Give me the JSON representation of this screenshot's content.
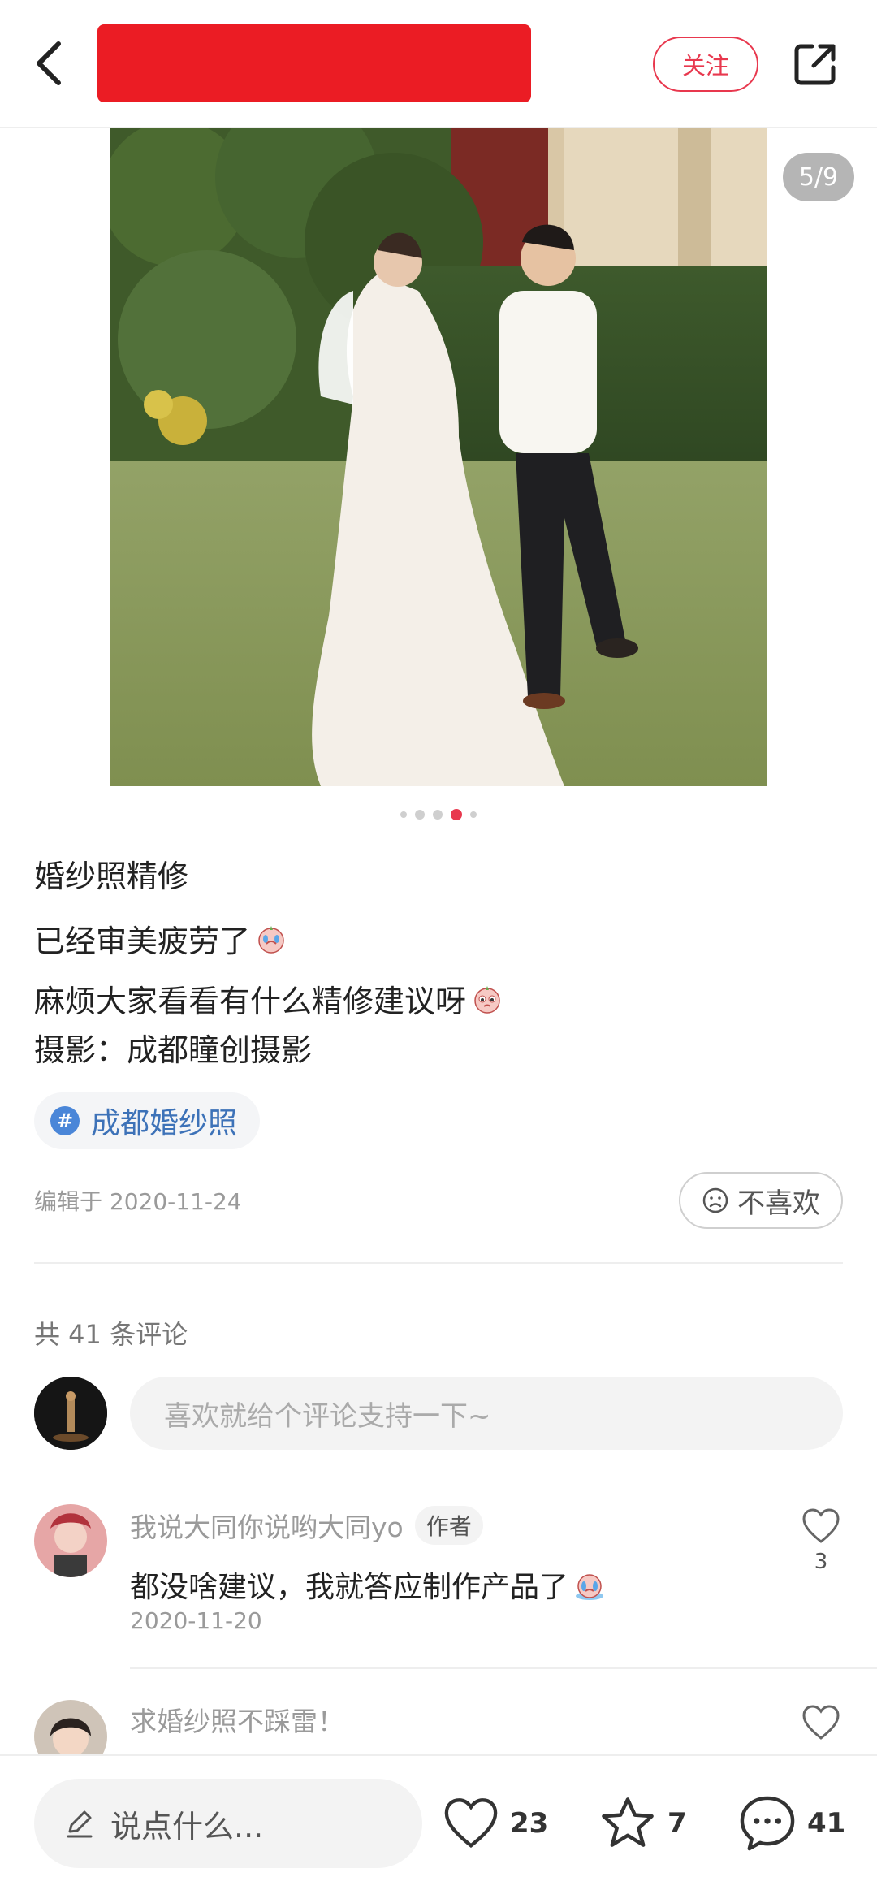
{
  "header": {
    "back_icon": "chevron-left-icon",
    "follow_label": "关注",
    "share_icon": "share-external-icon",
    "author_bar_color": "#eb1c24"
  },
  "gallery": {
    "counter": "5/9",
    "dot_count": 5,
    "active_dot": 4,
    "accent": "#e8384e"
  },
  "post": {
    "title": "婚纱照精修",
    "line1": "已经审美疲劳了",
    "line2": "麻烦大家看看有什么精修建议呀",
    "line3": "摄影：成都瞳创摄影",
    "tag": "成都婚纱照",
    "edit_date": "编辑于 2020-11-24",
    "dislike_label": "不喜欢"
  },
  "comments": {
    "count_label": "共 41 条评论",
    "input_placeholder": "喜欢就给个评论支持一下~",
    "items": [
      {
        "name": "我说大同你说哟大同yo",
        "badge": "作者",
        "text": "都没啥建议，我就答应制作产品了",
        "date": "2020-11-20",
        "likes": "3"
      },
      {
        "name": "求婚纱照不踩雷！"
      }
    ]
  },
  "bottom": {
    "say_placeholder": "说点什么...",
    "likes": "23",
    "favorites": "7",
    "comments": "41"
  }
}
